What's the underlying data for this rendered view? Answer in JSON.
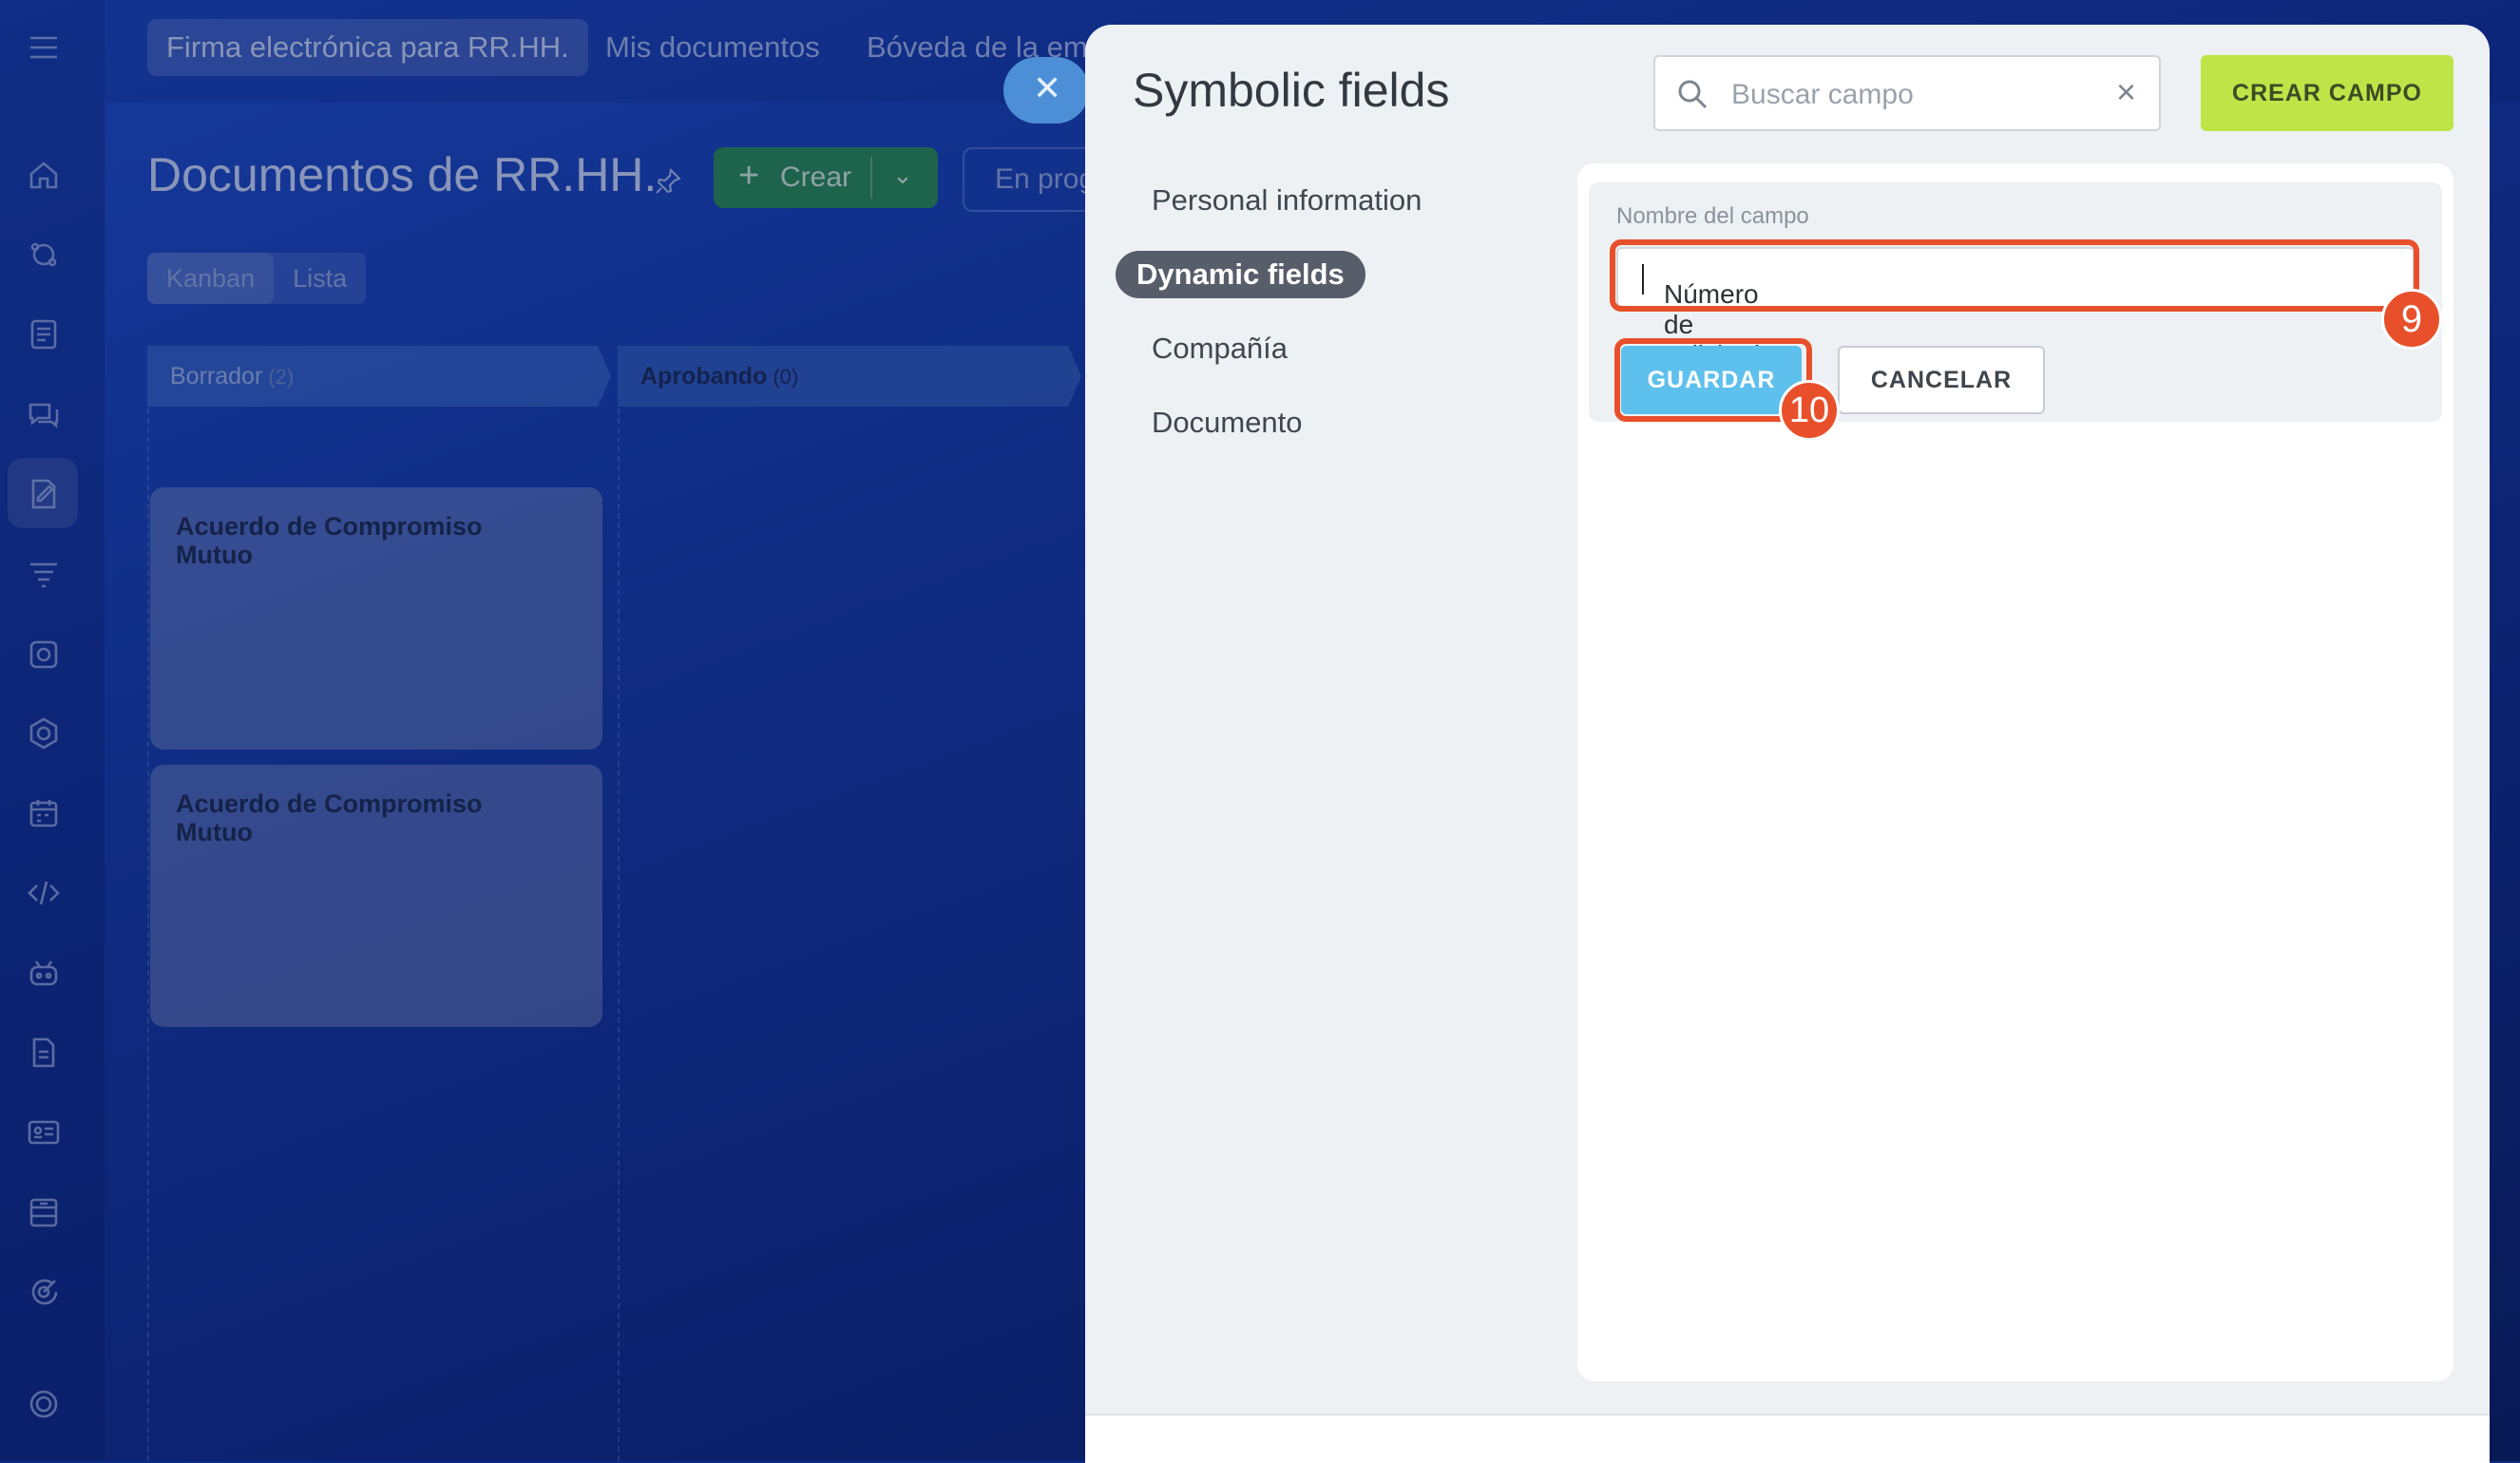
{
  "colors": {
    "accent_green": "#bfe447",
    "save_blue": "#5ec0ec",
    "highlight": "#e8502b",
    "panel_bg": "#eef1f4"
  },
  "topbar": {
    "tabs": [
      "Firma electrónica para RR.HH.",
      "Mis documentos",
      "Bóveda de la em"
    ]
  },
  "page": {
    "title": "Documentos de RR.HH.",
    "create_label": "Crear",
    "progress_label": "En prog",
    "views": [
      "Kanban",
      "Lista"
    ]
  },
  "kanban": {
    "stages": [
      {
        "name": "Borrador",
        "count": "(2)"
      },
      {
        "name": "Aprobando",
        "count": "(0)"
      }
    ],
    "cards": [
      "Acuerdo de Compromiso Mutuo",
      "Acuerdo de Compromiso Mutuo"
    ]
  },
  "rail_icons": [
    "menu-icon",
    "home-icon",
    "feed-icon",
    "tasks-icon",
    "chat-icon",
    "sign-icon",
    "filter-icon",
    "camera-icon",
    "hexagon-icon",
    "calendar-icon",
    "code-icon",
    "robot-icon",
    "document-icon",
    "id-card-icon",
    "archive-icon",
    "target-icon",
    "settings-icon"
  ],
  "panel": {
    "title": "Symbolic fields",
    "search_placeholder": "Buscar campo",
    "create_button": "CREAR CAMPO",
    "nav": [
      "Personal information",
      "Dynamic fields",
      "Compañía",
      "Documento"
    ],
    "selected_nav": "Dynamic fields",
    "form": {
      "label": "Nombre del campo",
      "value": "Número de solicitud",
      "save_label": "GUARDAR",
      "cancel_label": "CANCELAR"
    },
    "badges": [
      "9",
      "10"
    ]
  }
}
